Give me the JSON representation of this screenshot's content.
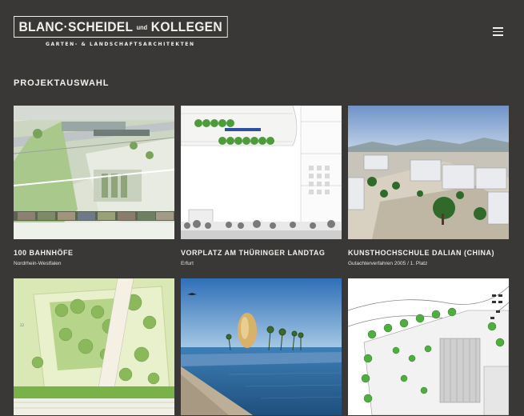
{
  "header": {
    "logo_text_1": "BLANC·SCHEIDEL",
    "logo_und": "und",
    "logo_text_2": "KOLLEGEN",
    "logo_subtitle": "GARTEN- & LANDSCHAFTSARCHITEKTEN",
    "menu_icon": "hamburger-menu-icon"
  },
  "section": {
    "title": "PROJEKTAUSWAHL"
  },
  "projects": [
    {
      "title": "100 BAHNHÖFE",
      "subtitle": "Nordrhein-Westfalen"
    },
    {
      "title": "VORPLATZ AM THÜRINGER LANDTAG",
      "subtitle": "Erfurt"
    },
    {
      "title": "KUNSTHOCHSCHULE DALIAN (CHINA)",
      "subtitle": "Gutachterverfahren 2005 / 1. Platz"
    },
    {
      "title": "",
      "subtitle": ""
    },
    {
      "title": "",
      "subtitle": ""
    },
    {
      "title": "",
      "subtitle": ""
    }
  ],
  "colors": {
    "background": "#3a3836",
    "text": "#f2f0ec"
  }
}
